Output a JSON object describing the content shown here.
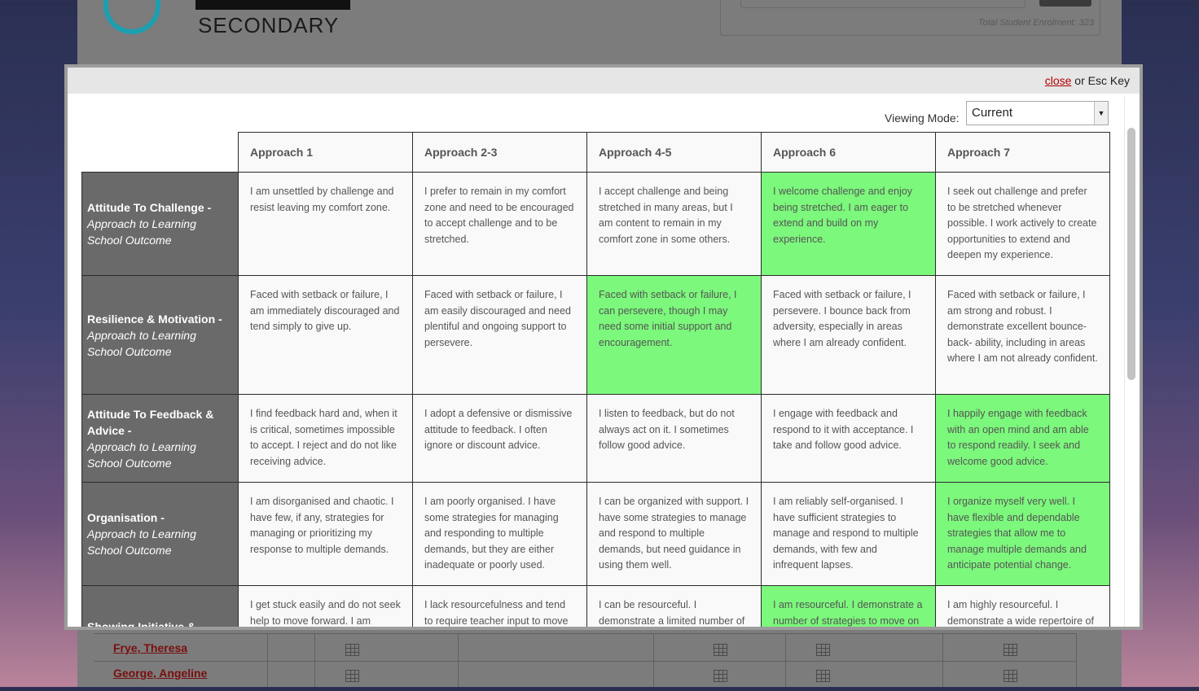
{
  "background_page": {
    "logo_text": "SECONDARY",
    "enrolment_text": "Total Student Enrolment: 323",
    "students": [
      "Frye, Theresa",
      "George, Angeline"
    ]
  },
  "modal": {
    "close_label": "close",
    "close_suffix": "or Esc Key",
    "viewing_mode_label": "Viewing Mode:",
    "viewing_mode_value": "Current",
    "highlight_color": "#7cf87c",
    "columns": [
      "Approach 1",
      "Approach 2-3",
      "Approach 4-5",
      "Approach 6",
      "Approach 7"
    ],
    "rows": [
      {
        "title": "Attitude To Challenge -",
        "sub1": "Approach to Learning",
        "sub2": "School Outcome",
        "selected": 3,
        "cells": [
          "I am unsettled by challenge and resist leaving my comfort zone.",
          "I prefer to remain in my comfort zone and need to be encouraged to accept challenge and to be stretched.",
          "I accept challenge and being stretched in many areas, but I am content to remain in my comfort zone in some others.",
          "I welcome challenge and enjoy being stretched. I am eager to extend and build on my experience.",
          "I seek out challenge and prefer to be stretched whenever possible. I work actively to create opportunities to extend and deepen my experience."
        ]
      },
      {
        "title": "Resilience & Motivation -",
        "sub1": "Approach to Learning",
        "sub2": "School Outcome",
        "selected": 2,
        "cells": [
          "Faced with setback or failure, I am immediately discouraged and tend simply to give up.",
          "Faced with setback or failure, I am easily discouraged and need plentiful and ongoing support to persevere.",
          "Faced with setback or failure, I can persevere, though I may need some initial support and encouragement.",
          "Faced with setback or failure, I persevere. I bounce back from adversity, especially in areas where I am already confident.",
          "Faced with setback or failure, I am strong and robust. I demonstrate excellent bounce-back- ability, including in areas where I am not already confident."
        ]
      },
      {
        "title": "Attitude To Feedback & Advice -",
        "sub1": "Approach to Learning",
        "sub2": "School Outcome",
        "selected": 4,
        "cells": [
          "I find feedback hard and, when it is critical, sometimes impossible to accept. I reject and do not like receiving advice.",
          "I adopt a defensive or dismissive attitude to feedback. I often ignore or discount advice.",
          "I listen to feedback, but do not always act on it. I sometimes follow good advice.",
          "I engage with feedback and respond to it with acceptance. I take and follow good advice.",
          "I happily engage with feedback with an open mind and am able to respond readily. I seek and welcome good advice."
        ]
      },
      {
        "title": "Organisation -",
        "sub1": "Approach to Learning",
        "sub2": "School Outcome",
        "selected": 4,
        "cells": [
          "I am disorganised and chaotic. I have few, if any, strategies for managing or prioritizing my response to multiple demands.",
          "I am poorly organised. I have some strategies for managing and responding to multiple demands, but they are either inadequate or poorly used.",
          "I can be organized with support. I have some strategies to manage and respond to multiple demands, but need guidance in using them well.",
          "I am reliably self-organised. I have sufficient strategies to manage and respond to multiple demands, with few and infrequent lapses.",
          "I organize myself very well. I have flexible and dependable strategies that allow me to manage multiple demands and anticipate potential change."
        ]
      },
      {
        "title": "Showing Initiative &",
        "sub1": "",
        "sub2": "",
        "selected": 3,
        "cells": [
          "I get stuck easily and do not seek help to move forward. I am",
          "I lack resourcefulness and tend to require teacher input to move",
          "I can be resourceful. I demonstrate a limited number of",
          "I am resourceful. I demonstrate a number of strategies to move on",
          "I am highly resourceful. I demonstrate a wide repertoire of"
        ]
      }
    ]
  }
}
